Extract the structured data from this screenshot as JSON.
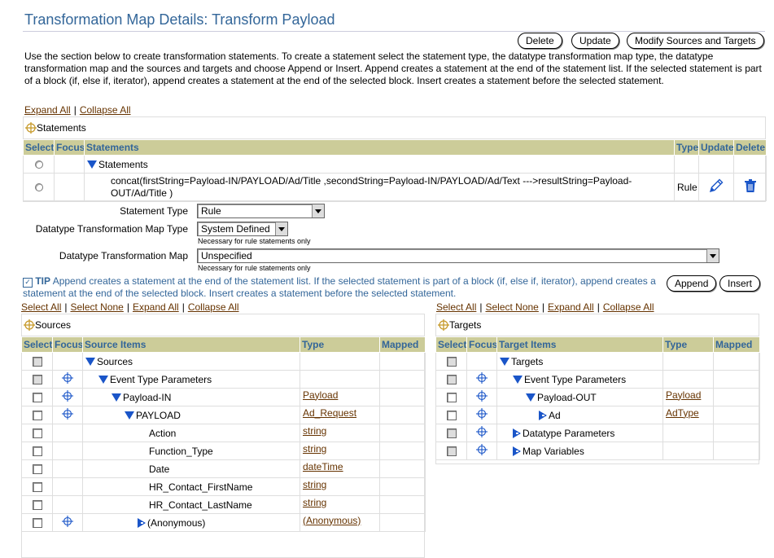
{
  "page": {
    "title": "Transformation Map Details: Transform Payload",
    "buttons": {
      "delete": "Delete",
      "update": "Update",
      "modify": "Modify Sources and Targets"
    },
    "intro": "Use the section below to create transformation statements. To create a statement select the statement type, the datatype transformation map type, the datatype transformation map and the sources and targets and choose Append or Insert. Append creates a statement at the end of the statement list. If the selected statement is part of a block (if, else if, iterator), append creates a statement at the end of the selected block. Insert creates a statement before the selected statement."
  },
  "statements": {
    "expand_all": "Expand All",
    "collapse_all": "Collapse All",
    "header": "Statements",
    "columns": {
      "select": "Select",
      "focus": "Focus",
      "statements": "Statements",
      "type": "Type",
      "update": "Update",
      "delete": "Delete"
    },
    "rows": [
      {
        "text": "Statements",
        "type": ""
      },
      {
        "text": "concat(firstString=Payload-IN/PAYLOAD/Ad/Title ,secondString=Payload-IN/PAYLOAD/Ad/Text --->resultString=Payload-OUT/Ad/Title )",
        "type": "Rule"
      }
    ]
  },
  "form": {
    "statement_type_label": "Statement Type",
    "statement_type_value": "Rule",
    "dtm_type_label": "Datatype Transformation Map Type",
    "dtm_type_value": "System Defined",
    "dtm_type_hint": "Necessary for rule statements only",
    "dtm_label": "Datatype Transformation Map",
    "dtm_value": "Unspecified",
    "dtm_hint": "Necessary for rule statements only"
  },
  "tip": {
    "label": "TIP",
    "text": "Append creates a statement at the end of the statement list. If the selected statement is part of a block (if, else if, iterator), append creates a statement at the end of the selected block. Insert creates a statement before the selected statement.",
    "append": "Append",
    "insert": "Insert"
  },
  "sources": {
    "links": {
      "select_all": "Select All",
      "select_none": "Select None",
      "expand_all": "Expand All",
      "collapse_all": "Collapse All"
    },
    "header": "Sources",
    "columns": {
      "select": "Select",
      "focus": "Focus",
      "items": "Source Items",
      "type": "Type",
      "mapped": "Mapped"
    },
    "rows": [
      {
        "label": "Sources",
        "type": "",
        "focus": false,
        "expander": "down",
        "indent": 0,
        "disabled": true
      },
      {
        "label": "Event Type Parameters",
        "type": "",
        "focus": true,
        "expander": "down",
        "indent": 1,
        "disabled": true
      },
      {
        "label": "Payload-IN",
        "type": "Payload",
        "focus": true,
        "expander": "down",
        "indent": 2,
        "disabled": false
      },
      {
        "label": "PAYLOAD",
        "type": "Ad_Request",
        "focus": true,
        "expander": "down",
        "indent": 3,
        "disabled": false
      },
      {
        "label": "Action",
        "type": "string",
        "focus": false,
        "expander": "none",
        "indent": 4,
        "disabled": false
      },
      {
        "label": "Function_Type",
        "type": "string",
        "focus": false,
        "expander": "none",
        "indent": 4,
        "disabled": false
      },
      {
        "label": "Date",
        "type": "dateTime",
        "focus": false,
        "expander": "none",
        "indent": 4,
        "disabled": false
      },
      {
        "label": "HR_Contact_FirstName",
        "type": "string",
        "focus": false,
        "expander": "none",
        "indent": 4,
        "disabled": false
      },
      {
        "label": "HR_Contact_LastName",
        "type": "string",
        "focus": false,
        "expander": "none",
        "indent": 4,
        "disabled": false
      },
      {
        "label": "(Anonymous)",
        "type": "(Anonymous)",
        "focus": true,
        "expander": "right",
        "indent": 4,
        "disabled": false
      }
    ]
  },
  "targets": {
    "links": {
      "select_all": "Select All",
      "select_none": "Select None",
      "expand_all": "Expand All",
      "collapse_all": "Collapse All"
    },
    "header": "Targets",
    "columns": {
      "select": "Select",
      "focus": "Focus",
      "items": "Target Items",
      "type": "Type",
      "mapped": "Mapped"
    },
    "rows": [
      {
        "label": "Targets",
        "type": "",
        "focus": false,
        "expander": "down",
        "indent": 0,
        "disabled": true
      },
      {
        "label": "Event Type Parameters",
        "type": "",
        "focus": true,
        "expander": "down",
        "indent": 1,
        "disabled": true
      },
      {
        "label": "Payload-OUT",
        "type": "Payload",
        "focus": true,
        "expander": "down",
        "indent": 2,
        "disabled": false
      },
      {
        "label": "Ad",
        "type": "AdType",
        "focus": true,
        "expander": "right",
        "indent": 3,
        "disabled": false
      },
      {
        "label": "Datatype Parameters",
        "type": "",
        "focus": true,
        "expander": "right",
        "indent": 1,
        "disabled": true
      },
      {
        "label": "Map Variables",
        "type": "",
        "focus": true,
        "expander": "right",
        "indent": 1,
        "disabled": true
      }
    ]
  },
  "colors": {
    "title": "#336699",
    "header_bg": "#cccc99",
    "link": "#663300",
    "expander": "#1a55c8",
    "pencil": "#1a55c8"
  },
  "icons": {
    "crosshair": "crosshair-icon",
    "pencil": "pencil-icon",
    "trash": "trash-icon",
    "expander_down": "triangle-down-icon",
    "expander_right": "triangle-right-icon",
    "tip_check": "checkmark-icon"
  }
}
